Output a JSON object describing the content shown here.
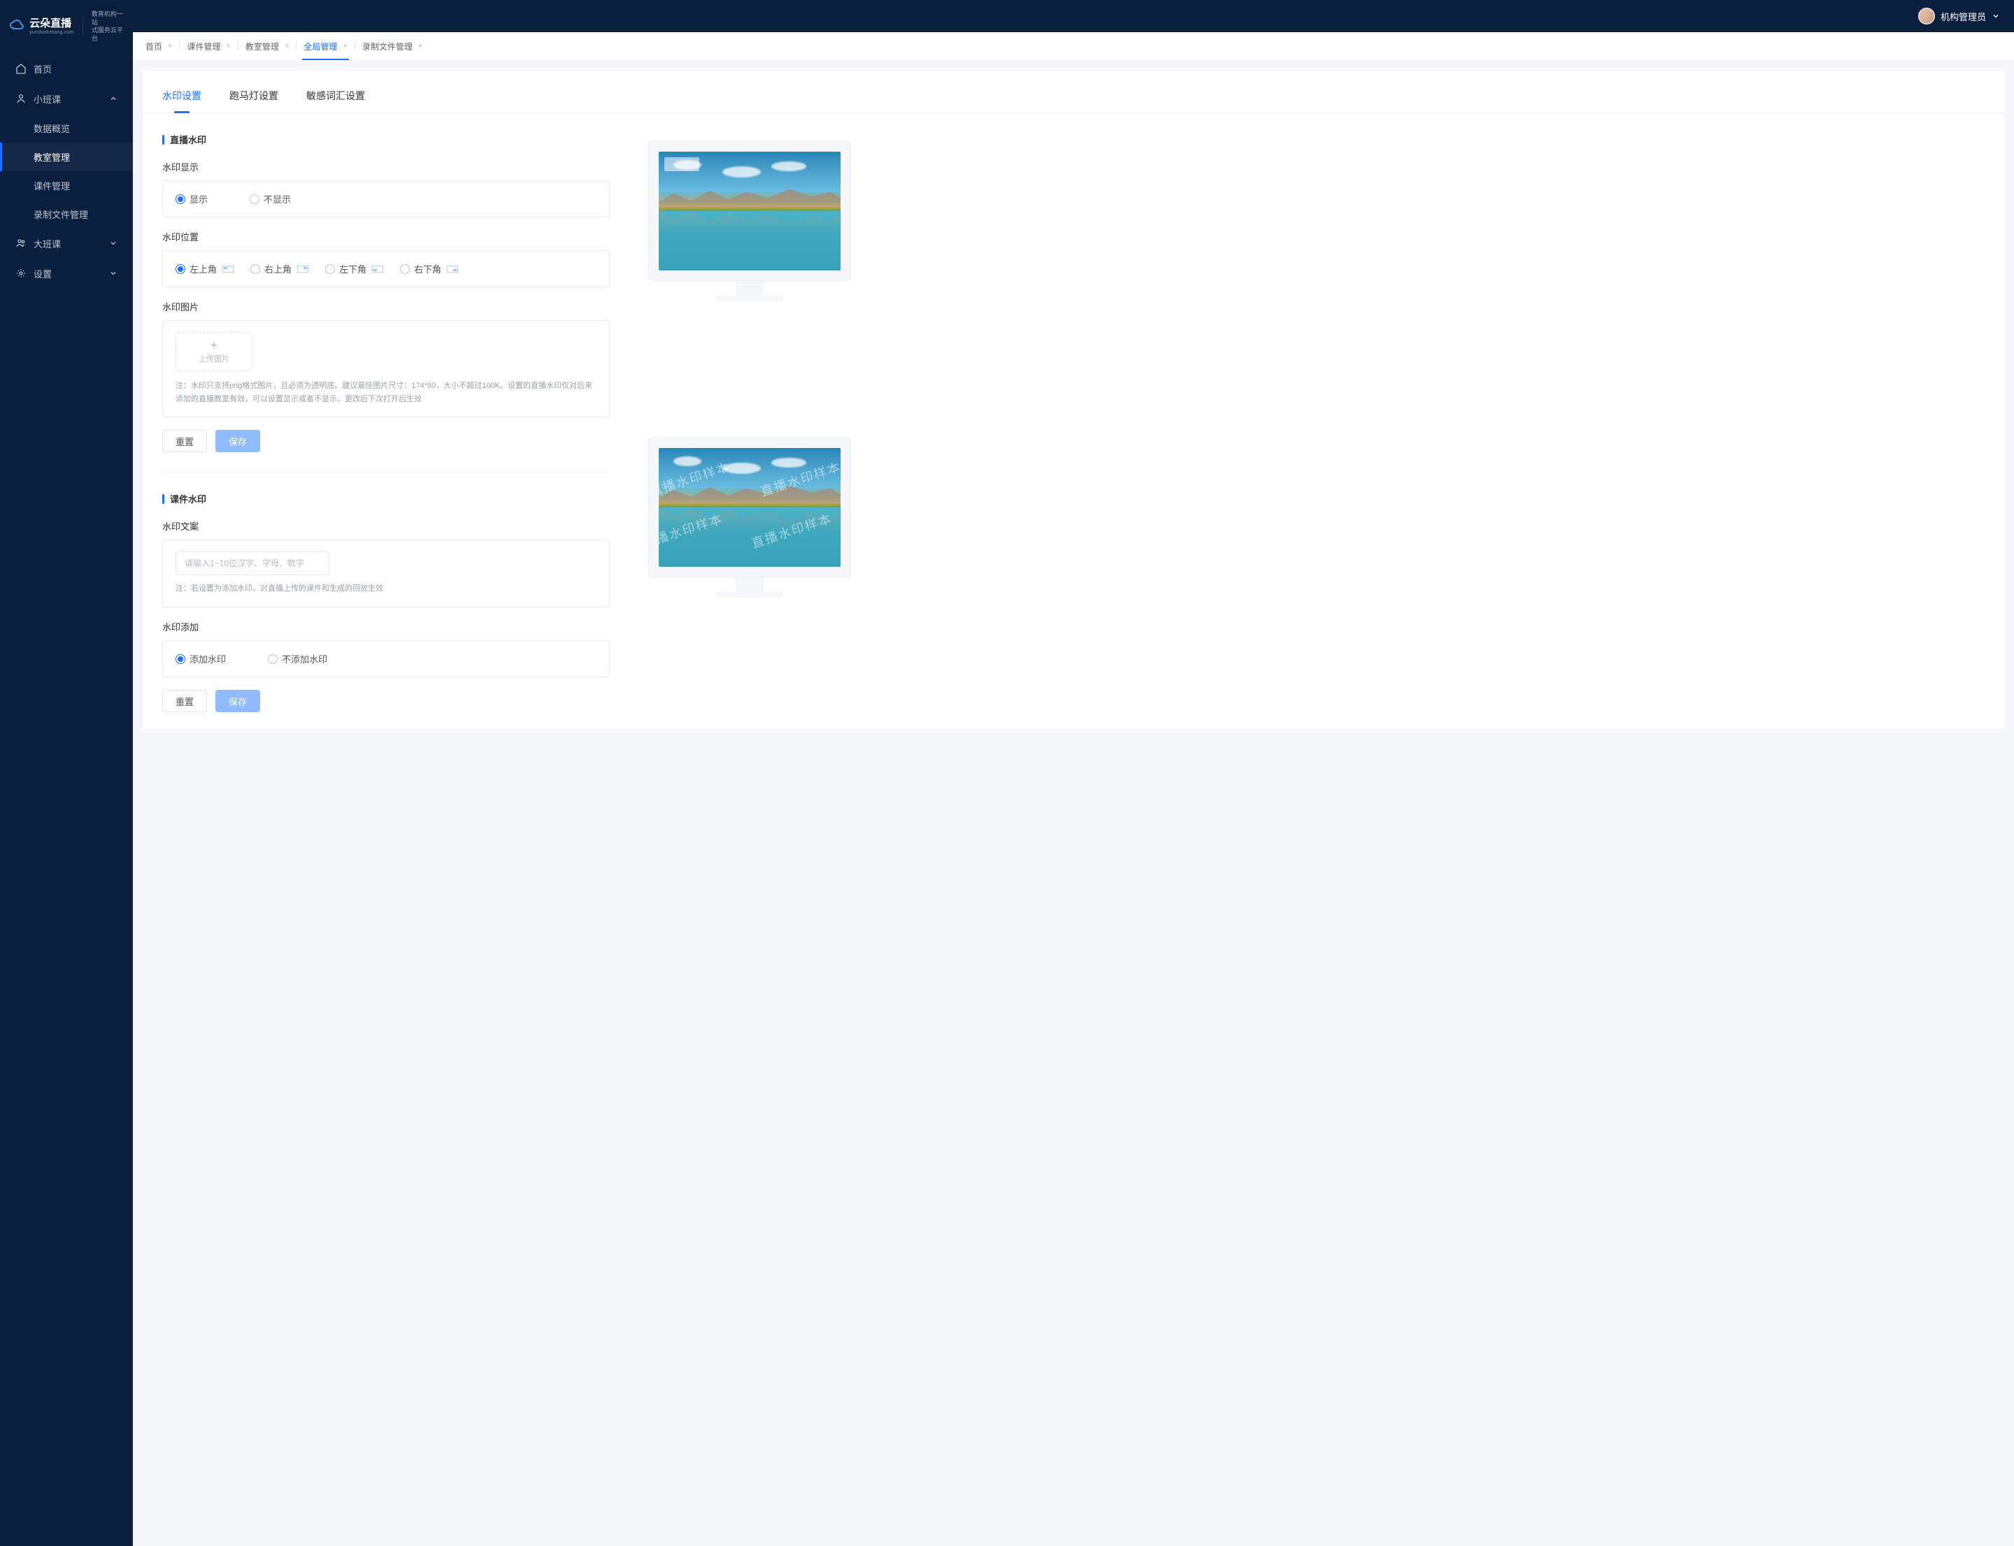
{
  "brand": {
    "name": "云朵直播",
    "domain": "yunduoketang.com",
    "tagline_l1": "教育机构一站",
    "tagline_l2": "式服务云平台"
  },
  "user": {
    "name": "机构管理员"
  },
  "sidebar": {
    "items": [
      {
        "label": "首页",
        "icon": "home"
      },
      {
        "label": "小班课",
        "icon": "user",
        "expanded": true,
        "children": [
          {
            "label": "数据概览"
          },
          {
            "label": "教室管理",
            "active": true
          },
          {
            "label": "课件管理"
          },
          {
            "label": "录制文件管理"
          }
        ]
      },
      {
        "label": "大班课",
        "icon": "users",
        "expanded": false
      },
      {
        "label": "设置",
        "icon": "gear",
        "expanded": false
      }
    ]
  },
  "tabs": [
    {
      "label": "首页",
      "closable": true
    },
    {
      "label": "课件管理",
      "closable": true
    },
    {
      "label": "教室管理",
      "closable": true
    },
    {
      "label": "全局管理",
      "closable": true,
      "active": true
    },
    {
      "label": "录制文件管理",
      "closable": true
    }
  ],
  "inner_tabs": [
    {
      "label": "水印设置",
      "active": true
    },
    {
      "label": "跑马灯设置"
    },
    {
      "label": "敏感词汇设置"
    }
  ],
  "sections": {
    "live": {
      "title": "直播水印",
      "display": {
        "label": "水印显示",
        "options": [
          "显示",
          "不显示"
        ],
        "selected": 0
      },
      "position": {
        "label": "水印位置",
        "options": [
          "左上角",
          "右上角",
          "左下角",
          "右下角"
        ],
        "selected": 0
      },
      "image": {
        "label": "水印图片",
        "upload_text": "上传图片",
        "hint": "注：水印只支持png格式图片，且必须为透明底。建议最佳图片尺寸：174*80，大小不超过100K。设置的直播水印仅对后来添加的直播教室有效，可以设置显示或者不显示，更改后下次打开后生效"
      },
      "buttons": {
        "reset": "重置",
        "save": "保存"
      }
    },
    "courseware": {
      "title": "课件水印",
      "text": {
        "label": "水印文案",
        "placeholder": "请输入1~10位汉字、字母、数字",
        "hint": "注：若设置为添加水印，对直播上传的课件和生成的回放生效"
      },
      "add": {
        "label": "水印添加",
        "options": [
          "添加水印",
          "不添加水印"
        ],
        "selected": 0
      },
      "buttons": {
        "reset": "重置",
        "save": "保存"
      },
      "sample_text": "直播水印样本"
    }
  }
}
